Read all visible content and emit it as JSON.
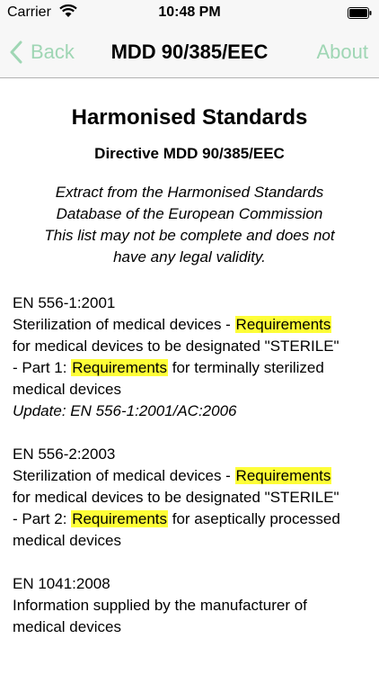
{
  "status_bar": {
    "carrier": "Carrier",
    "time": "10:48 PM"
  },
  "nav": {
    "back_label": "Back",
    "title": "MDD 90/385/EEC",
    "about_label": "About",
    "accent_color": "#9fd6b4"
  },
  "content": {
    "heading": "Harmonised Standards",
    "subheading": "Directive MDD 90/385/EEC",
    "note_lines": [
      "Extract from the Harmonised Standards",
      "Database of the European Commission",
      "This list may not be complete and does not",
      "have any legal validity."
    ],
    "highlight_color": "#fefe38",
    "entries": [
      {
        "code": "EN 556-1:2001",
        "l1_pre": "Sterilization of medical devices - ",
        "l1_hl": "Requirements",
        "l2": "for medical devices to be designated \"STERILE\"",
        "l3_pre": "- Part 1: ",
        "l3_hl": "Requirements",
        "l3_post": " for terminally sterilized",
        "l4": "medical devices",
        "update": "Update: EN 556-1:2001/AC:2006"
      },
      {
        "code": "EN 556-2:2003",
        "l1_pre": "Sterilization of medical devices - ",
        "l1_hl": "Requirements",
        "l2": "for medical devices to be designated \"STERILE\"",
        "l3_pre": "- Part 2: ",
        "l3_hl": "Requirements",
        "l3_post": " for aseptically processed",
        "l4": "medical devices"
      },
      {
        "code": "EN 1041:2008",
        "l1": "Information supplied by the manufacturer of",
        "l2": "medical devices"
      }
    ]
  }
}
